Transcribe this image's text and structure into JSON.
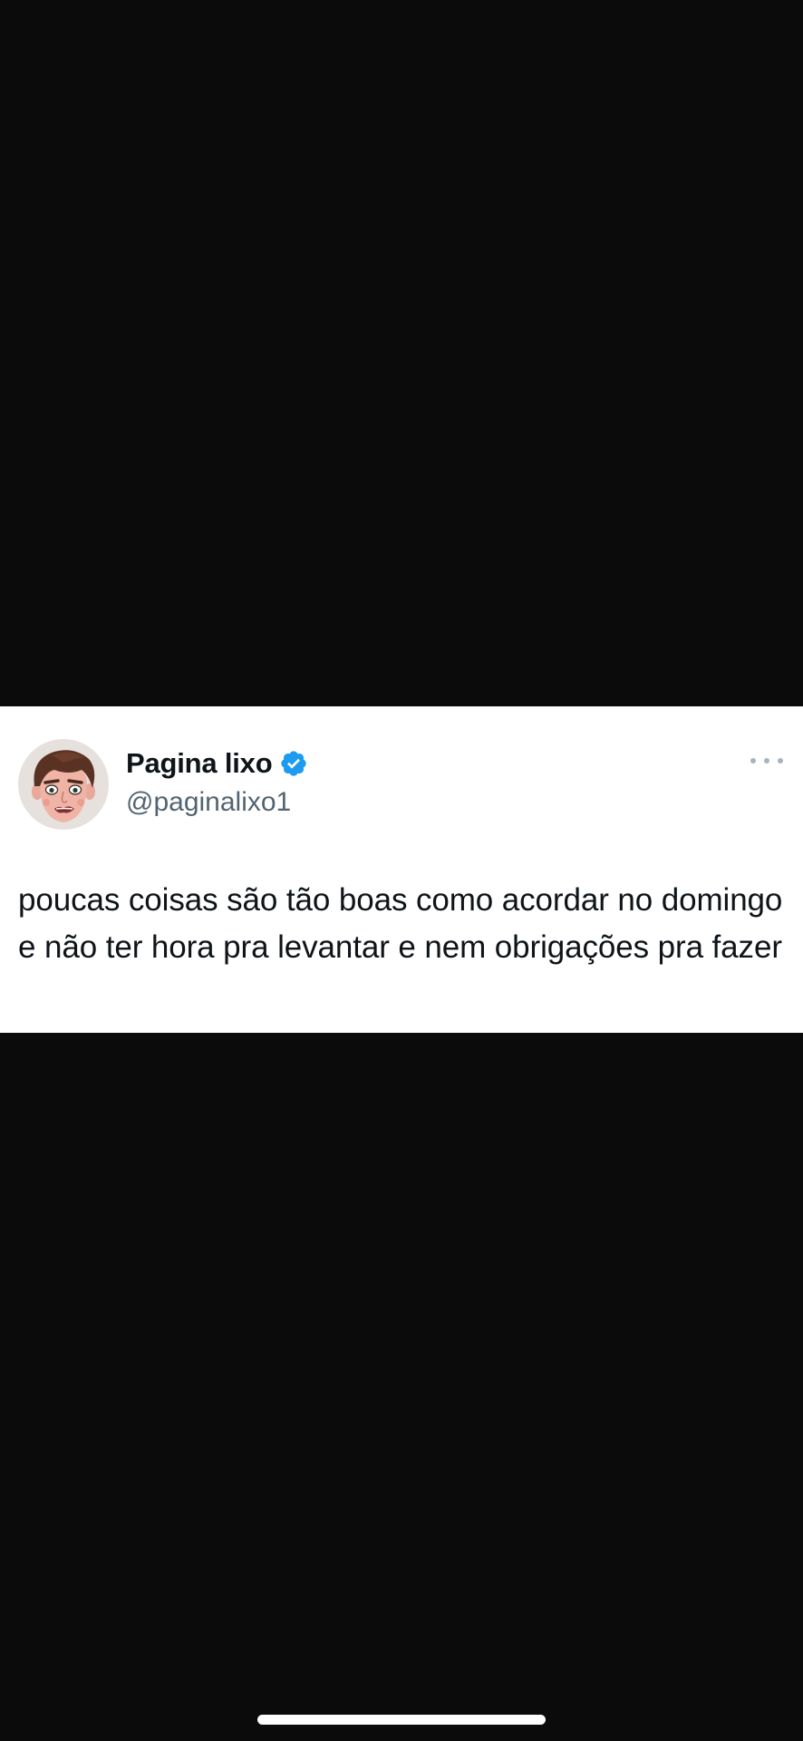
{
  "tweet": {
    "author": {
      "display_name": "Pagina lixo",
      "handle": "@paginalixo1",
      "verified": true,
      "verified_badge_color": "#1d9bf0",
      "avatar": "cartoon-face-avatar"
    },
    "more_icon": "more-options-icon",
    "text": "poucas coisas são tão boas como acordar no domingo e não ter hora pra levantar e nem obrigações pra fazer"
  },
  "colors": {
    "background": "#0b0b0c",
    "card": "#ffffff",
    "name": "#0f1419",
    "handle": "#536471"
  }
}
